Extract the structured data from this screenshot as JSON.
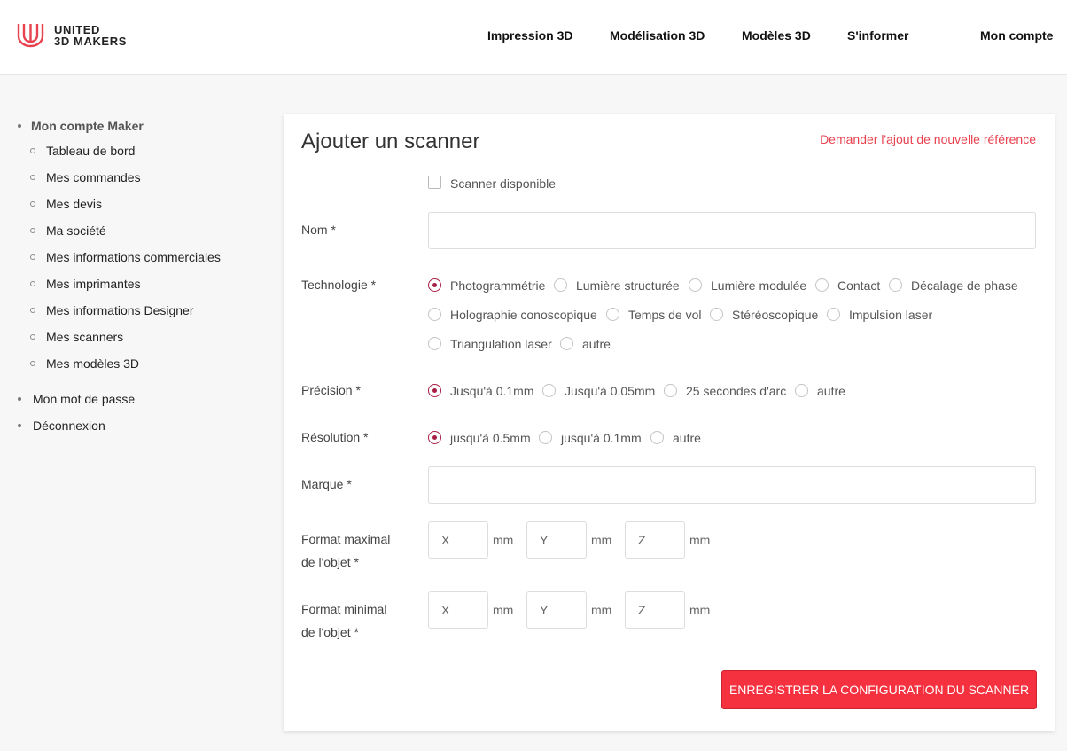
{
  "header": {
    "logo_line1": "UNITED",
    "logo_line2": "3D MAKERS",
    "brand_color": "#e8424f",
    "nav": [
      "Impression 3D",
      "Modélisation 3D",
      "Modèles 3D",
      "S'informer",
      "Mon compte"
    ]
  },
  "sidebar": {
    "section_title": "Mon compte Maker",
    "items": [
      "Tableau de bord",
      "Mes commandes",
      "Mes devis",
      "Ma société",
      "Mes informations commerciales",
      "Mes imprimantes",
      "Mes informations Designer",
      "Mes scanners",
      "Mes modèles 3D"
    ],
    "password": "Mon mot de passe",
    "logout": "Déconnexion"
  },
  "form": {
    "title": "Ajouter un scanner",
    "request_link": "Demander l'ajout de nouvelle référence",
    "available_label": "Scanner disponible",
    "name_label": "Nom *",
    "name_value": "",
    "technology_label": "Technologie *",
    "technology_options": [
      "Photogrammétrie",
      "Lumière structurée",
      "Lumière modulée",
      "Contact",
      "Décalage de phase",
      "Holographie conoscopique",
      "Temps de vol",
      "Stéréoscopique",
      "Impulsion laser",
      "Triangulation laser",
      "autre"
    ],
    "technology_selected": "Photogrammétrie",
    "precision_label": "Précision *",
    "precision_options": [
      "Jusqu'à 0.1mm",
      "Jusqu'à 0.05mm",
      "25 secondes d'arc",
      "autre"
    ],
    "precision_selected": "Jusqu'à 0.1mm",
    "resolution_label": "Résolution *",
    "resolution_options": [
      "jusqu'à 0.5mm",
      "jusqu'à 0.1mm",
      "autre"
    ],
    "resolution_selected": "jusqu'à 0.5mm",
    "brand_label": "Marque *",
    "brand_value": "",
    "max_format_label_1": "Format maximal",
    "max_format_label_2": "de l'objet *",
    "min_format_label_1": "Format minimal",
    "min_format_label_2": "de l'objet *",
    "dim_placeholders": [
      "X",
      "Y",
      "Z"
    ],
    "unit": "mm",
    "save_label": "ENREGISTRER LA CONFIGURATION DU SCANNER",
    "accent_color": "#a81f45",
    "button_color": "#f5303f"
  }
}
